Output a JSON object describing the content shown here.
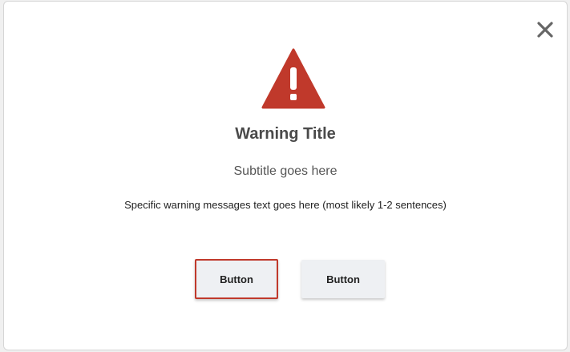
{
  "dialog": {
    "title": "Warning Title",
    "subtitle": "Subtitle goes here",
    "message": "Specific warning messages text goes here (most likely 1-2 sentences)",
    "icon": "warning-triangle-icon",
    "close_icon": "close-icon",
    "primary_button_label": "Button",
    "secondary_button_label": "Button"
  },
  "colors": {
    "warning_red": "#c0392b",
    "button_bg": "#eef0f3",
    "close_icon": "#666666",
    "title_text": "#4a4a4a"
  }
}
